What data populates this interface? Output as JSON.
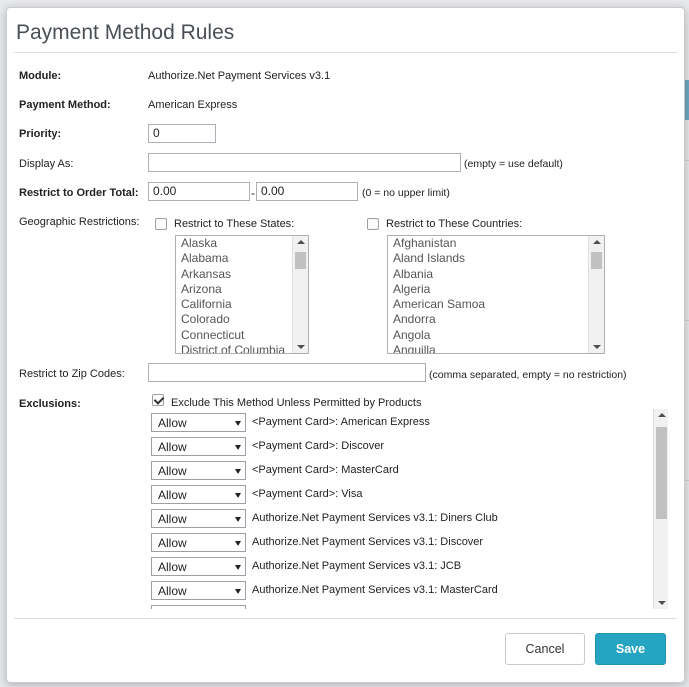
{
  "dialog": {
    "title": "Payment Method Rules"
  },
  "form": {
    "module": {
      "label": "Module:",
      "value": "Authorize.Net Payment Services v3.1"
    },
    "payment_method": {
      "label": "Payment Method:",
      "value": "American Express"
    },
    "priority": {
      "label": "Priority:",
      "value": "0"
    },
    "display_as": {
      "label": "Display As:",
      "value": "",
      "hint": "(empty = use default)"
    },
    "order_total": {
      "label": "Restrict to Order Total:",
      "min": "0.00",
      "separator": "-",
      "max": "0.00",
      "hint": "(0 = no upper limit)"
    },
    "geo": {
      "label": "Geographic Restrictions:",
      "states_label": "Restrict to These States:",
      "countries_label": "Restrict to These Countries:",
      "states": [
        "Alaska",
        "Alabama",
        "Arkansas",
        "Arizona",
        "California",
        "Colorado",
        "Connecticut",
        "District of Columbia"
      ],
      "countries": [
        "Afghanistan",
        "Aland Islands",
        "Albania",
        "Algeria",
        "American Samoa",
        "Andorra",
        "Angola",
        "Anguilla"
      ]
    },
    "zip": {
      "label": "Restrict to Zip Codes:",
      "value": "",
      "hint": "(comma separated, empty = no restriction)"
    },
    "exclusions": {
      "label": "Exclusions:",
      "checkbox_label": "Exclude This Method Unless Permitted by Products",
      "rows": [
        {
          "value": "Allow",
          "text": "<Payment Card>: American Express"
        },
        {
          "value": "Allow",
          "text": "<Payment Card>: Discover"
        },
        {
          "value": "Allow",
          "text": "<Payment Card>: MasterCard"
        },
        {
          "value": "Allow",
          "text": "<Payment Card>: Visa"
        },
        {
          "value": "Allow",
          "text": "Authorize.Net Payment Services v3.1: Diners Club"
        },
        {
          "value": "Allow",
          "text": "Authorize.Net Payment Services v3.1: Discover"
        },
        {
          "value": "Allow",
          "text": "Authorize.Net Payment Services v3.1: JCB"
        },
        {
          "value": "Allow",
          "text": "Authorize.Net Payment Services v3.1: MasterCard"
        },
        {
          "value": "",
          "text": ""
        }
      ]
    }
  },
  "footer": {
    "cancel": "Cancel",
    "save": "Save"
  },
  "colors": {
    "primary": "#26a5c2",
    "border": "#aab0b6"
  }
}
